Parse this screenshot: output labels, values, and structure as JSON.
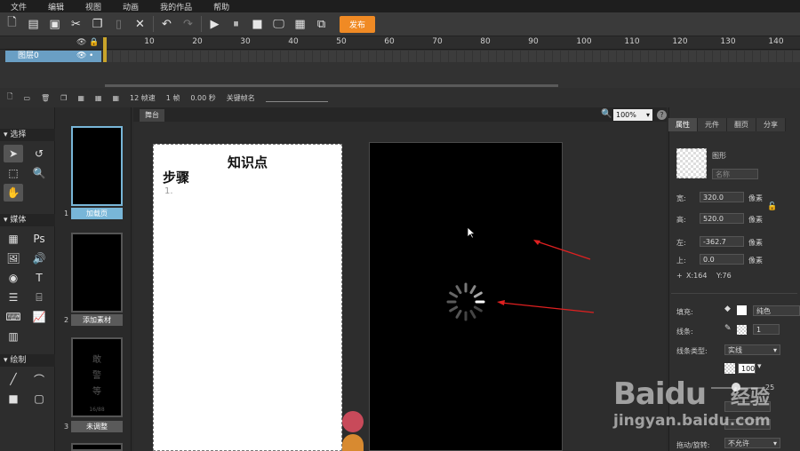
{
  "menu": [
    "文件",
    "编辑",
    "视图",
    "动画",
    "我的作品",
    "帮助"
  ],
  "toolbar": {
    "publish_label": "发布"
  },
  "timeline": {
    "ticks": [
      "10",
      "20",
      "30",
      "40",
      "50",
      "60",
      "70",
      "80",
      "90",
      "100",
      "110",
      "120",
      "130",
      "140"
    ],
    "layer_name": "图层0",
    "status": {
      "fps": "12 帧速",
      "frame": "1 帧",
      "time": "0.00 秒",
      "keyframe_label": "关键帧名"
    }
  },
  "left_tools": {
    "select_section": "选择",
    "media_section": "媒体",
    "draw_section": "绘制"
  },
  "pages": [
    {
      "num": "1",
      "label": "加载页"
    },
    {
      "num": "2",
      "label": "添加素材"
    },
    {
      "num": "3",
      "label": "未调整"
    }
  ],
  "thumb3_lines": [
    "敢",
    "警",
    "等"
  ],
  "thumb3_footer": "16/88",
  "stage": {
    "tab": "舞台",
    "zoom": "100%",
    "title_text": "知识点",
    "step_text": "步骤",
    "list_number": "1."
  },
  "props": {
    "tabs": [
      "属性",
      "元件",
      "翻页",
      "分享"
    ],
    "shape_type": "图形",
    "name_placeholder": "名称",
    "width_label": "宽:",
    "width_value": "320.0",
    "height_label": "高:",
    "height_value": "520.0",
    "left_label": "左:",
    "left_value": "-362.7",
    "top_label": "上:",
    "top_value": "0.0",
    "unit": "像素",
    "coords_x": "X:164",
    "coords_y": "Y:76",
    "fill_label": "填充:",
    "fill_value": "纯色",
    "stroke_label": "线条:",
    "stroke_value": "1",
    "stroke_type_label": "线条类型:",
    "stroke_type_value": "实线",
    "opacity_value": "100",
    "slider_value": "25",
    "drag_label": "拖动/旋转:",
    "drag_value": "不允许"
  },
  "watermark": {
    "brand": "Baidu",
    "sub": "经验",
    "url": "jingyan.baidu.com"
  },
  "colors": {
    "accent": "#f08a24",
    "selection": "#78b6d8",
    "annotation": "#e02020"
  }
}
